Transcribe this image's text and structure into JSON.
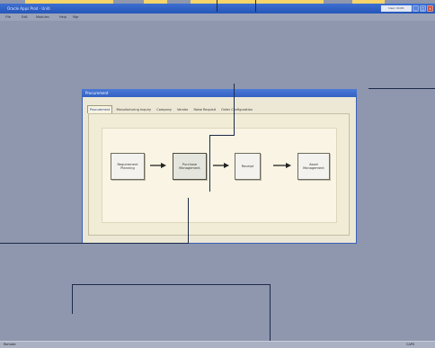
{
  "app": {
    "title": "Oracle Apps Prod - Uniti"
  },
  "menu": [
    "File",
    "Edit",
    "Modules",
    "Help",
    "Mgr"
  ],
  "title_info": "User:  01/01",
  "window": {
    "title": "Procurement",
    "tabs": [
      "Procurement",
      "Manufacturing Inquiry",
      "Company",
      "Vendor",
      "Raise Requisit",
      "Order Configuration"
    ],
    "active_tab": 0
  },
  "flow": {
    "nodes": [
      "Requirement Planning",
      "Purchase Management",
      "Receipt",
      "Asset Management"
    ],
    "highlighted_node": 1
  },
  "status": {
    "left": "Remote",
    "right": "CAPS"
  },
  "colors": {
    "desktop": "#8e97ad",
    "titlebar": "#2f5ec4",
    "accent_yellow": "#f7d46a",
    "annotation": "#1c2a4a"
  },
  "icons": {
    "minimize": "minimize-icon",
    "maximize": "maximize-icon",
    "close": "close-icon",
    "arrow": "right-arrow-icon"
  }
}
